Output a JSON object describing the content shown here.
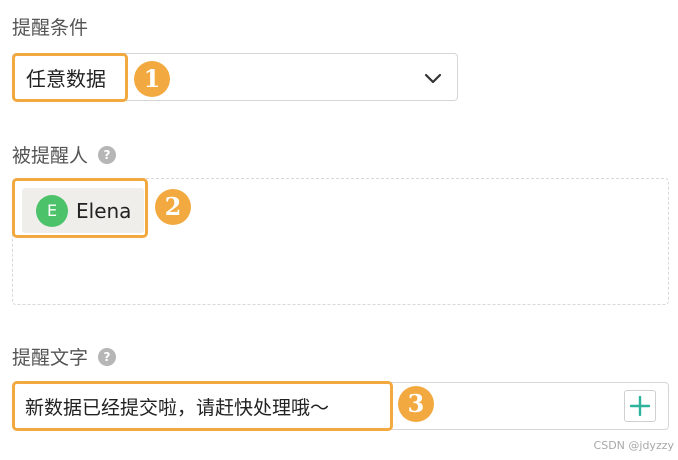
{
  "condition": {
    "label": "提醒条件",
    "selected_value": "任意数据",
    "badge": "1"
  },
  "recipients": {
    "label": "被提醒人",
    "help_symbol": "?",
    "badge": "2",
    "users": [
      {
        "initial": "E",
        "name": "Elena",
        "avatar_color": "#4cc36a"
      }
    ]
  },
  "message": {
    "label": "提醒文字",
    "help_symbol": "?",
    "value": "新数据已经提交啦，请赶快处理哦～",
    "badge": "3"
  },
  "colors": {
    "highlight": "#f2a93f",
    "add_icon": "#2bb39b"
  },
  "watermark": "CSDN @jdyzzy"
}
